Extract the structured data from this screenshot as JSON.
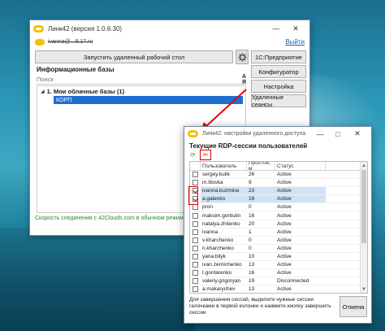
{
  "main_window": {
    "title": "Линк42 (версия 1.0.6.30)",
    "user_line": "ivanna@...8.17.ru",
    "exit_link": "Выйти",
    "remote_desktop_button": "Запустить удаленный рабочий стол",
    "enterprise_button": "1С:Предприятие",
    "configurator_button": "Конфигуратор",
    "settings_button": "Настройка",
    "remote_sessions_button": "Удаленные сеансы",
    "infobases_label": "Информационные базы",
    "search_placeholder": "Поиск",
    "sort_label_a": "А",
    "sort_label_z": "Я",
    "tree_group": "1. Мои облачные базы (1)",
    "tree_item": "КОРП",
    "status_text": "Скорость соединения с 42Clouds.com в обычном режиме - 34"
  },
  "sessions_window": {
    "title": "Линк42: настройки удаленного доступа",
    "heading": "Текущие RDP-сессии пользователей",
    "columns": [
      "",
      "Пользователь",
      "Простой, м",
      "Статус"
    ],
    "rows": [
      {
        "user": "sergey.kulik",
        "idle": "26",
        "status": "Active",
        "checked": false
      },
      {
        "user": "m.litovka",
        "idle": "9",
        "status": "Active",
        "checked": false
      },
      {
        "user": "ivanna.kuzmina",
        "idle": "23",
        "status": "Active",
        "checked": true
      },
      {
        "user": "a.galenko",
        "idle": "16",
        "status": "Active",
        "checked": true
      },
      {
        "user": "pron",
        "idle": "0",
        "status": "Active",
        "checked": false
      },
      {
        "user": "maksim.gorbulin",
        "idle": "16",
        "status": "Active",
        "checked": false
      },
      {
        "user": "natalya.zhilenko",
        "idle": "20",
        "status": "Active",
        "checked": false
      },
      {
        "user": "ivanna",
        "idle": "1",
        "status": "Active",
        "checked": false
      },
      {
        "user": "v.kharchenko",
        "idle": "0",
        "status": "Active",
        "checked": false
      },
      {
        "user": "n.kharchenko",
        "idle": "0",
        "status": "Active",
        "checked": false
      },
      {
        "user": "yana.bilyk",
        "idle": "10",
        "status": "Active",
        "checked": false
      },
      {
        "user": "ivan.zernichenko",
        "idle": "13",
        "status": "Active",
        "checked": false
      },
      {
        "user": "t.gontarenko",
        "idle": "16",
        "status": "Active",
        "checked": false
      },
      {
        "user": "valeriy.grigoryan",
        "idle": "19",
        "status": "Disconnected",
        "checked": false
      },
      {
        "user": "a.makarychev",
        "idle": "13",
        "status": "Active",
        "checked": false
      }
    ],
    "hint": "Для завершения сессий, выделите нужные сессии галочками в первой колонке и нажмите кнопку завершить сессии",
    "cancel_button": "Отмена"
  },
  "icons": {
    "app_logo": "link42-logo-icon",
    "gear": "gear-icon",
    "refresh": "refresh-icon",
    "end_sessions": "end-sessions-icon"
  },
  "colors": {
    "selection": "#1f6fd0",
    "status_green": "#2a8a2a",
    "highlight_red": "#dd0000"
  }
}
